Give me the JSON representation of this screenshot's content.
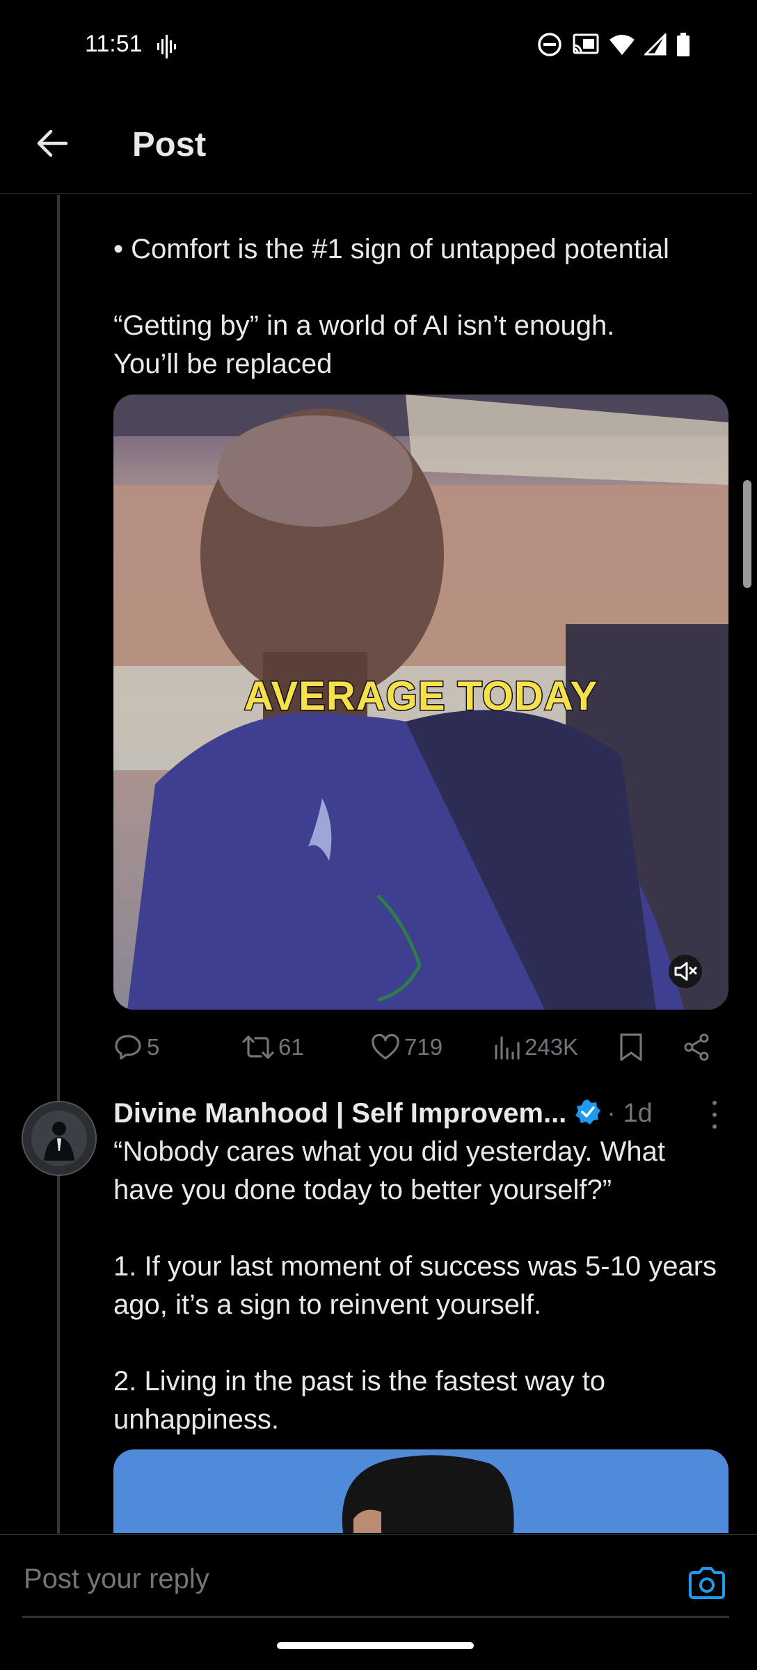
{
  "status_bar": {
    "time": "11:51"
  },
  "header": {
    "title": "Post"
  },
  "tweet": {
    "bullet_line": "• Comfort is the #1 sign of untapped potential",
    "paragraph": "“Getting by” in a world of AI isn’t enough.\nYou’ll be replaced",
    "video_caption": "AVERAGE TODAY",
    "actions": {
      "replies": "5",
      "reposts": "61",
      "likes": "719",
      "views": "243K"
    }
  },
  "reply": {
    "author": "Divine Manhood | Self Improvem...",
    "time": "· 1d",
    "text": "“Nobody cares what you did yesterday. What have you done today to better yourself?”\n\n1. If your last moment of success was 5-10 years ago, it’s a sign to reinvent yourself.\n\n2. Living in the past is the fastest way to unhappiness."
  },
  "compose": {
    "placeholder": "Post your reply"
  },
  "colors": {
    "background": "#000000",
    "text": "#e7e9ea",
    "muted": "#71767b",
    "accent": "#1d9bf0"
  }
}
